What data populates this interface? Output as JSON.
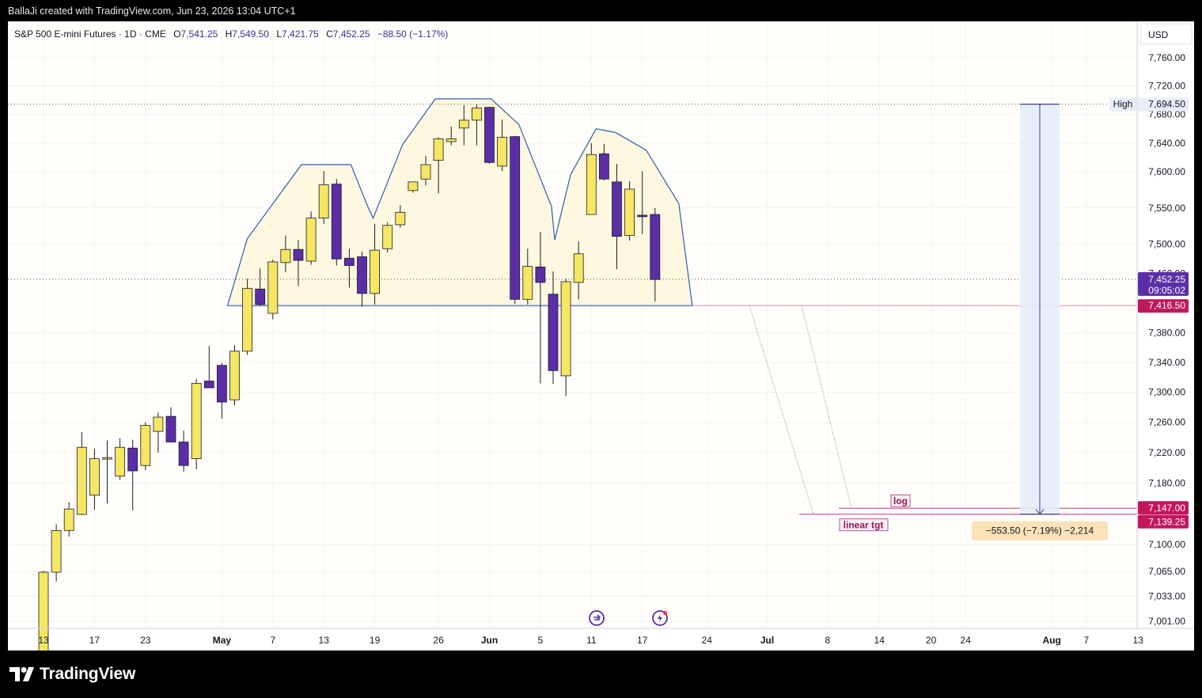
{
  "header": {
    "credit": "BallaJi created with TradingView.com, Jun 23, 2026 13:04 UTC+1"
  },
  "legend": {
    "symbol": "S&P 500 E-mini Futures · 1D · CME",
    "open_label": "O",
    "open": "7,541.25",
    "high_label": "H",
    "high": "7,549.50",
    "low_label": "L",
    "low": "7,421.75",
    "close_label": "C",
    "close": "7,452.25",
    "change": "−88.50 (−1.17%)"
  },
  "currency": "USD",
  "chart_data": {
    "type": "candlestick",
    "x_axis_labels": [
      {
        "label": "13",
        "date": "2026-04-13"
      },
      {
        "label": "17",
        "date": "2026-04-17"
      },
      {
        "label": "23",
        "date": "2026-04-23"
      },
      {
        "label": "May",
        "date": "2026-05-01"
      },
      {
        "label": "7",
        "date": "2026-05-07"
      },
      {
        "label": "13",
        "date": "2026-05-13"
      },
      {
        "label": "19",
        "date": "2026-05-19"
      },
      {
        "label": "26",
        "date": "2026-05-26"
      },
      {
        "label": "Jun",
        "date": "2026-06-01"
      },
      {
        "label": "5",
        "date": "2026-06-05"
      },
      {
        "label": "11",
        "date": "2026-06-11"
      },
      {
        "label": "17",
        "date": "2026-06-17"
      },
      {
        "label": "24",
        "date": "2026-06-24"
      },
      {
        "label": "Jul",
        "date": "2026-07-01"
      },
      {
        "label": "8",
        "date": "2026-07-08"
      },
      {
        "label": "14",
        "date": "2026-07-14"
      },
      {
        "label": "20",
        "date": "2026-07-20"
      },
      {
        "label": "24",
        "date": "2026-07-24"
      },
      {
        "label": "Aug",
        "date": "2026-08-03"
      },
      {
        "label": "7",
        "date": "2026-08-07"
      },
      {
        "label": "13",
        "date": "2026-08-13"
      }
    ],
    "y_axis_labels": [
      "7,760.00",
      "7,720.00",
      "7,680.00",
      "7,640.00",
      "7,600.00",
      "7,550.00",
      "7,500.00",
      "7,460.00",
      "7,380.00",
      "7,340.00",
      "7,300.00",
      "7,260.00",
      "7,220.00",
      "7,180.00",
      "7,100.00",
      "7,065.00",
      "7,033.00",
      "7,001.00"
    ],
    "y_axis_scale": "log",
    "up_color": "#f5e663",
    "down_color": "#5b2ea6",
    "candles": [
      {
        "date": "2026-04-13",
        "open": 6960,
        "high": 7066,
        "low": 6940,
        "close": 7064
      },
      {
        "date": "2026-04-14",
        "open": 7064,
        "high": 7126,
        "low": 7052,
        "close": 7118
      },
      {
        "date": "2026-04-15",
        "open": 7118,
        "high": 7155,
        "low": 7110,
        "close": 7146
      },
      {
        "date": "2026-04-16",
        "open": 7139,
        "high": 7247,
        "low": 7138,
        "close": 7227
      },
      {
        "date": "2026-04-17",
        "open": 7164,
        "high": 7225,
        "low": 7145,
        "close": 7212
      },
      {
        "date": "2026-04-20",
        "open": 7213,
        "high": 7236,
        "low": 7153,
        "close": 7213
      },
      {
        "date": "2026-04-21",
        "open": 7189,
        "high": 7239,
        "low": 7184,
        "close": 7227
      },
      {
        "date": "2026-04-22",
        "open": 7226,
        "high": 7237,
        "low": 7144,
        "close": 7196
      },
      {
        "date": "2026-04-23",
        "open": 7203,
        "high": 7260,
        "low": 7197,
        "close": 7256
      },
      {
        "date": "2026-04-24",
        "open": 7248,
        "high": 7273,
        "low": 7220,
        "close": 7267
      },
      {
        "date": "2026-04-27",
        "open": 7268,
        "high": 7280,
        "low": 7235,
        "close": 7234
      },
      {
        "date": "2026-04-28",
        "open": 7234,
        "high": 7249,
        "low": 7195,
        "close": 7203
      },
      {
        "date": "2026-04-29",
        "open": 7212,
        "high": 7318,
        "low": 7198,
        "close": 7312
      },
      {
        "date": "2026-04-30",
        "open": 7315,
        "high": 7362,
        "low": 7308,
        "close": 7306
      },
      {
        "date": "2026-05-01",
        "open": 7336,
        "high": 7339,
        "low": 7265,
        "close": 7287
      },
      {
        "date": "2026-05-04",
        "open": 7290,
        "high": 7363,
        "low": 7283,
        "close": 7355
      },
      {
        "date": "2026-05-05",
        "open": 7355,
        "high": 7453,
        "low": 7350,
        "close": 7440
      },
      {
        "date": "2026-05-06",
        "open": 7439,
        "high": 7467,
        "low": 7416,
        "close": 7418
      },
      {
        "date": "2026-05-07",
        "open": 7406,
        "high": 7479,
        "low": 7398,
        "close": 7476
      },
      {
        "date": "2026-05-08",
        "open": 7475,
        "high": 7512,
        "low": 7462,
        "close": 7493
      },
      {
        "date": "2026-05-11",
        "open": 7493,
        "high": 7506,
        "low": 7443,
        "close": 7478
      },
      {
        "date": "2026-05-12",
        "open": 7477,
        "high": 7545,
        "low": 7472,
        "close": 7536
      },
      {
        "date": "2026-05-13",
        "open": 7536,
        "high": 7601,
        "low": 7528,
        "close": 7582
      },
      {
        "date": "2026-05-14",
        "open": 7583,
        "high": 7590,
        "low": 7471,
        "close": 7480
      },
      {
        "date": "2026-05-15",
        "open": 7481,
        "high": 7494,
        "low": 7441,
        "close": 7471
      },
      {
        "date": "2026-05-18",
        "open": 7483,
        "high": 7490,
        "low": 7415,
        "close": 7433
      },
      {
        "date": "2026-05-19",
        "open": 7433,
        "high": 7528,
        "low": 7418,
        "close": 7492
      },
      {
        "date": "2026-05-20",
        "open": 7494,
        "high": 7530,
        "low": 7489,
        "close": 7526
      },
      {
        "date": "2026-05-21",
        "open": 7527,
        "high": 7554,
        "low": 7523,
        "close": 7544
      },
      {
        "date": "2026-05-22",
        "open": 7574,
        "high": 7586,
        "low": 7571,
        "close": 7586
      },
      {
        "date": "2026-05-25",
        "open": 7590,
        "high": 7622,
        "low": 7581,
        "close": 7610
      },
      {
        "date": "2026-05-26",
        "open": 7616,
        "high": 7648,
        "low": 7570,
        "close": 7646
      },
      {
        "date": "2026-05-27",
        "open": 7642,
        "high": 7663,
        "low": 7637,
        "close": 7646
      },
      {
        "date": "2026-05-28",
        "open": 7661,
        "high": 7693,
        "low": 7637,
        "close": 7672
      },
      {
        "date": "2026-05-29",
        "open": 7672,
        "high": 7694,
        "low": 7637,
        "close": 7689
      },
      {
        "date": "2026-06-01",
        "open": 7690,
        "high": 7691,
        "low": 7611,
        "close": 7613
      },
      {
        "date": "2026-06-02",
        "open": 7608,
        "high": 7673,
        "low": 7601,
        "close": 7648
      },
      {
        "date": "2026-06-03",
        "open": 7649,
        "high": 7650,
        "low": 7419,
        "close": 7425
      },
      {
        "date": "2026-06-04",
        "open": 7425,
        "high": 7494,
        "low": 7418,
        "close": 7470
      },
      {
        "date": "2026-06-05",
        "open": 7469,
        "high": 7517,
        "low": 7312,
        "close": 7448
      },
      {
        "date": "2026-06-08",
        "open": 7432,
        "high": 7463,
        "low": 7311,
        "close": 7329
      },
      {
        "date": "2026-06-09",
        "open": 7322,
        "high": 7453,
        "low": 7295,
        "close": 7449
      },
      {
        "date": "2026-06-10",
        "open": 7448,
        "high": 7504,
        "low": 7425,
        "close": 7487
      },
      {
        "date": "2026-06-11",
        "open": 7541,
        "high": 7640,
        "low": 7541,
        "close": 7624
      },
      {
        "date": "2026-06-12",
        "open": 7625,
        "high": 7639,
        "low": 7588,
        "close": 7590
      },
      {
        "date": "2026-06-15",
        "open": 7586,
        "high": 7611,
        "low": 7466,
        "close": 7511
      },
      {
        "date": "2026-06-16",
        "open": 7512,
        "high": 7587,
        "low": 7505,
        "close": 7576
      },
      {
        "date": "2026-06-17",
        "open": 7540,
        "high": 7601,
        "low": 7514,
        "close": 7538
      },
      {
        "date": "2026-06-18",
        "open": 7541,
        "high": 7550,
        "low": 7422,
        "close": 7452
      }
    ],
    "pattern": "head and shoulders",
    "neckline": 7416.5,
    "current_price": 7452.25,
    "countdown": "09:05:02",
    "high_marker": {
      "label": "High",
      "value": 7694.5
    },
    "targets": [
      {
        "label": "log",
        "value": 7147.0
      },
      {
        "label": "linear tgt",
        "value": 7139.25
      }
    ],
    "measure": {
      "text": "−553.50 (−7.19%) −2,214",
      "from": 7694.5,
      "to": 7139.25
    },
    "price_labels": {
      "current": "7,452.25",
      "neckline": "7,416.50",
      "high": "7,694.50",
      "log_target": "7,147.00",
      "linear_target": "7,139.25",
      "high_text": "High"
    },
    "colors": {
      "pattern_fill": "#fdf8df",
      "pattern_stroke": "#2f5bb0",
      "target_line": "#d63384",
      "label_bg": "#c2185b",
      "current_label_bg": "#5b2ea6",
      "measure_bg": "#e3edf8",
      "measure_arrow": "#3b3b8f",
      "measure_label_bg": "#fbe2b8"
    }
  },
  "branding": {
    "name": "TradingView"
  }
}
